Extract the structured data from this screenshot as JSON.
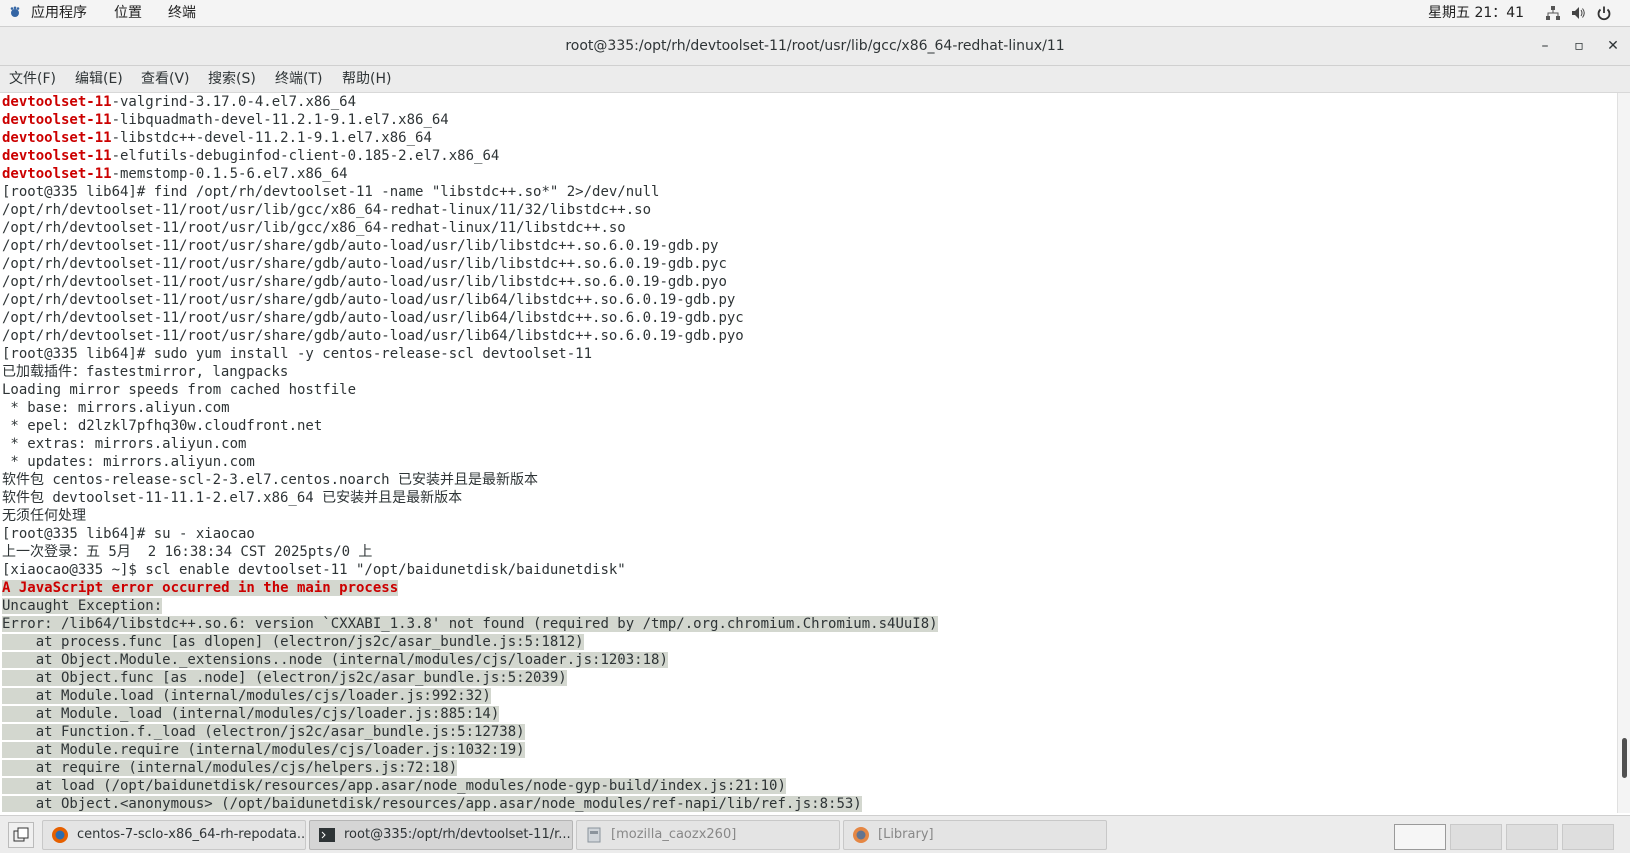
{
  "top_panel": {
    "applications": "应用程序",
    "places": "位置",
    "terminal": "终端",
    "clock": "星期五 21：41"
  },
  "window": {
    "title": "root@335:/opt/rh/devtoolset-11/root/usr/lib/gcc/x86_64-redhat-linux/11",
    "minimize": "–",
    "maximize": "▫",
    "close": "✕"
  },
  "menubar": {
    "file": "文件(F)",
    "edit": "编辑(E)",
    "view": "查看(V)",
    "search": "搜索(S)",
    "terminal": "终端(T)",
    "help": "帮助(H)"
  },
  "terminal": {
    "lines": [
      {
        "red": "devtoolset-11",
        "text": "-valgrind-3.17.0-4.el7.x86_64"
      },
      {
        "red": "devtoolset-11",
        "text": "-libquadmath-devel-11.2.1-9.1.el7.x86_64"
      },
      {
        "red": "devtoolset-11",
        "text": "-libstdc++-devel-11.2.1-9.1.el7.x86_64"
      },
      {
        "red": "devtoolset-11",
        "text": "-elfutils-debuginfod-client-0.185-2.el7.x86_64"
      },
      {
        "red": "devtoolset-11",
        "text": "-memstomp-0.1.5-6.el7.x86_64"
      },
      {
        "text": "[root@335 lib64]# find /opt/rh/devtoolset-11 -name \"libstdc++.so*\" 2>/dev/null"
      },
      {
        "text": "/opt/rh/devtoolset-11/root/usr/lib/gcc/x86_64-redhat-linux/11/32/libstdc++.so"
      },
      {
        "text": "/opt/rh/devtoolset-11/root/usr/lib/gcc/x86_64-redhat-linux/11/libstdc++.so"
      },
      {
        "text": "/opt/rh/devtoolset-11/root/usr/share/gdb/auto-load/usr/lib/libstdc++.so.6.0.19-gdb.py"
      },
      {
        "text": "/opt/rh/devtoolset-11/root/usr/share/gdb/auto-load/usr/lib/libstdc++.so.6.0.19-gdb.pyc"
      },
      {
        "text": "/opt/rh/devtoolset-11/root/usr/share/gdb/auto-load/usr/lib/libstdc++.so.6.0.19-gdb.pyo"
      },
      {
        "text": "/opt/rh/devtoolset-11/root/usr/share/gdb/auto-load/usr/lib64/libstdc++.so.6.0.19-gdb.py"
      },
      {
        "text": "/opt/rh/devtoolset-11/root/usr/share/gdb/auto-load/usr/lib64/libstdc++.so.6.0.19-gdb.pyc"
      },
      {
        "text": "/opt/rh/devtoolset-11/root/usr/share/gdb/auto-load/usr/lib64/libstdc++.so.6.0.19-gdb.pyo"
      },
      {
        "text": "[root@335 lib64]# sudo yum install -y centos-release-scl devtoolset-11"
      },
      {
        "text": "已加载插件：fastestmirror, langpacks"
      },
      {
        "text": "Loading mirror speeds from cached hostfile"
      },
      {
        "text": " * base: mirrors.aliyun.com"
      },
      {
        "text": " * epel: d2lzkl7pfhq30w.cloudfront.net"
      },
      {
        "text": " * extras: mirrors.aliyun.com"
      },
      {
        "text": " * updates: mirrors.aliyun.com"
      },
      {
        "text": "软件包 centos-release-scl-2-3.el7.centos.noarch 已安装并且是最新版本"
      },
      {
        "text": "软件包 devtoolset-11-11.1-2.el7.x86_64 已安装并且是最新版本"
      },
      {
        "text": "无须任何处理"
      },
      {
        "text": "[root@335 lib64]# su - xiaocao"
      },
      {
        "text": "上一次登录：五 5月  2 16:38:34 CST 2025pts/0 上"
      },
      {
        "text": "[xiaocao@335 ~]$ scl enable devtoolset-11 \"/opt/baidunetdisk/baidunetdisk\""
      },
      {
        "red": "A JavaScript error occurred in the main process",
        "sel": true
      },
      {
        "text": "Uncaught Exception:",
        "sel": true
      },
      {
        "text": "Error: /lib64/libstdc++.so.6: version `CXXABI_1.3.8' not found (required by /tmp/.org.chromium.Chromium.s4UuI8)",
        "sel": true
      },
      {
        "text": "    at process.func [as dlopen] (electron/js2c/asar_bundle.js:5:1812)",
        "sel": true
      },
      {
        "text": "    at Object.Module._extensions..node (internal/modules/cjs/loader.js:1203:18)",
        "sel": true
      },
      {
        "text": "    at Object.func [as .node] (electron/js2c/asar_bundle.js:5:2039)",
        "sel": true
      },
      {
        "text": "    at Module.load (internal/modules/cjs/loader.js:992:32)",
        "sel": true
      },
      {
        "text": "    at Module._load (internal/modules/cjs/loader.js:885:14)",
        "sel": true
      },
      {
        "text": "    at Function.f._load (electron/js2c/asar_bundle.js:5:12738)",
        "sel": true
      },
      {
        "text": "    at Module.require (internal/modules/cjs/loader.js:1032:19)",
        "sel": true
      },
      {
        "text": "    at require (internal/modules/cjs/helpers.js:72:18)",
        "sel": true
      },
      {
        "text": "    at load (/opt/baidunetdisk/resources/app.asar/node_modules/node-gyp-build/index.js:21:10)",
        "sel": true
      },
      {
        "text": "    at Object.<anonymous> (/opt/baidunetdisk/resources/app.asar/node_modules/ref-napi/lib/ref.js:8:53)",
        "sel": true
      }
    ]
  },
  "taskbar": {
    "tasks": [
      {
        "label": "centos-7-sclo-x86_64-rh-repodata...",
        "icon": "firefox-icon"
      },
      {
        "label": "root@335:/opt/rh/devtoolset-11/r...",
        "icon": "terminal-icon"
      },
      {
        "label": "[mozilla_caozx260]",
        "icon": "file-manager-icon"
      },
      {
        "label": "[Library]",
        "icon": "firefox-icon"
      }
    ]
  },
  "colors": {
    "error_red": "#cc0000",
    "selection": "#d3d7cf",
    "panel": "#f4f4f4"
  }
}
